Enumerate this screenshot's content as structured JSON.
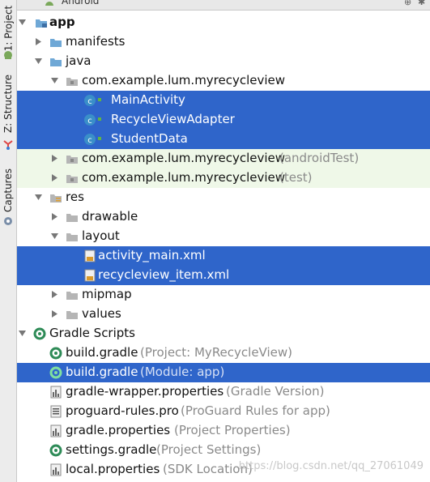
{
  "side_tabs": [
    {
      "label": "1: Project"
    },
    {
      "label": "Z: Structure"
    },
    {
      "label": "Captures"
    }
  ],
  "header": {
    "title": "Android"
  },
  "tree": [
    {
      "label": "app",
      "hint": "",
      "bold": true
    },
    {
      "label": "manifests",
      "hint": ""
    },
    {
      "label": "java",
      "hint": ""
    },
    {
      "label": "com.example.lum.myrecycleview",
      "hint": ""
    },
    {
      "label": "MainActivity",
      "hint": ""
    },
    {
      "label": "RecycleViewAdapter",
      "hint": ""
    },
    {
      "label": "StudentData",
      "hint": ""
    },
    {
      "label": "com.example.lum.myrecycleview",
      "hint": "(androidTest)"
    },
    {
      "label": "com.example.lum.myrecycleview",
      "hint": "(test)"
    },
    {
      "label": "res",
      "hint": ""
    },
    {
      "label": "drawable",
      "hint": ""
    },
    {
      "label": "layout",
      "hint": ""
    },
    {
      "label": "activity_main.xml",
      "hint": ""
    },
    {
      "label": "recycleview_item.xml",
      "hint": ""
    },
    {
      "label": "mipmap",
      "hint": ""
    },
    {
      "label": "values",
      "hint": ""
    },
    {
      "label": "Gradle Scripts",
      "hint": ""
    },
    {
      "label": "build.gradle",
      "hint": "(Project: MyRecycleView)"
    },
    {
      "label": "build.gradle",
      "hint": "(Module: app)"
    },
    {
      "label": "gradle-wrapper.properties",
      "hint": "(Gradle Version)"
    },
    {
      "label": "proguard-rules.pro",
      "hint": "(ProGuard Rules for app)"
    },
    {
      "label": "gradle.properties",
      "hint": "(Project Properties)"
    },
    {
      "label": "settings.gradle",
      "hint": "(Project Settings)"
    },
    {
      "label": "local.properties",
      "hint": "(SDK Location)"
    }
  ],
  "watermark": "https://blog.csdn.net/qq_27061049",
  "colors": {
    "selection": "#2f65ca",
    "test_row": "#eff8e8",
    "folder": "#6fa8d6"
  }
}
